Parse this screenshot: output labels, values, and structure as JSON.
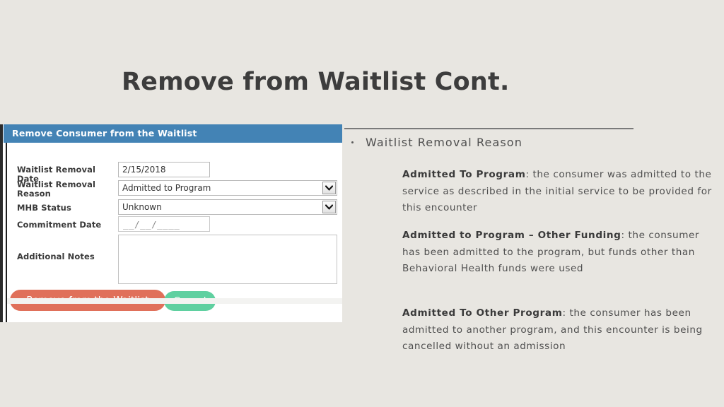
{
  "slide": {
    "title": "Remove from Waitlist Cont.",
    "background_color": "#e8e6e1"
  },
  "screenshot_panel": {
    "header_title": "Remove Consumer from the Waitlist",
    "header_color": "#4383b5",
    "fields": [
      {
        "label": "Waitlist Removal Date",
        "type": "text",
        "value": "2/15/2018"
      },
      {
        "label": "Waitlist Removal Reason",
        "type": "select",
        "value": "Admitted to Program"
      },
      {
        "label": "MHB Status",
        "type": "select",
        "value": "Unknown"
      },
      {
        "label": "Commitment Date",
        "type": "date-mask",
        "value": "__/__/____"
      },
      {
        "label": "Additional Notes",
        "type": "textarea",
        "value": ""
      }
    ],
    "buttons": {
      "primary_label": "Remove from the Waitlist",
      "primary_color": "#e0705a",
      "secondary_label": "Cancel",
      "secondary_color": "#5fd0a0"
    }
  },
  "content": {
    "bullet": "Waitlist Removal Reason",
    "items": [
      {
        "term": "Admitted To Program",
        "separator": ": ",
        "description": "the consumer was admitted to the service as described in the initial service to be provided for this encounter"
      },
      {
        "term": "Admitted to Program – Other Funding",
        "separator": ": ",
        "description": "the consumer has been admitted to the program, but funds other than Behavioral Health funds were used"
      },
      {
        "term": "Admitted To Other Program",
        "separator": ": ",
        "description": "the consumer has been admitted to another program, and this encounter is being cancelled without an admission"
      }
    ]
  }
}
